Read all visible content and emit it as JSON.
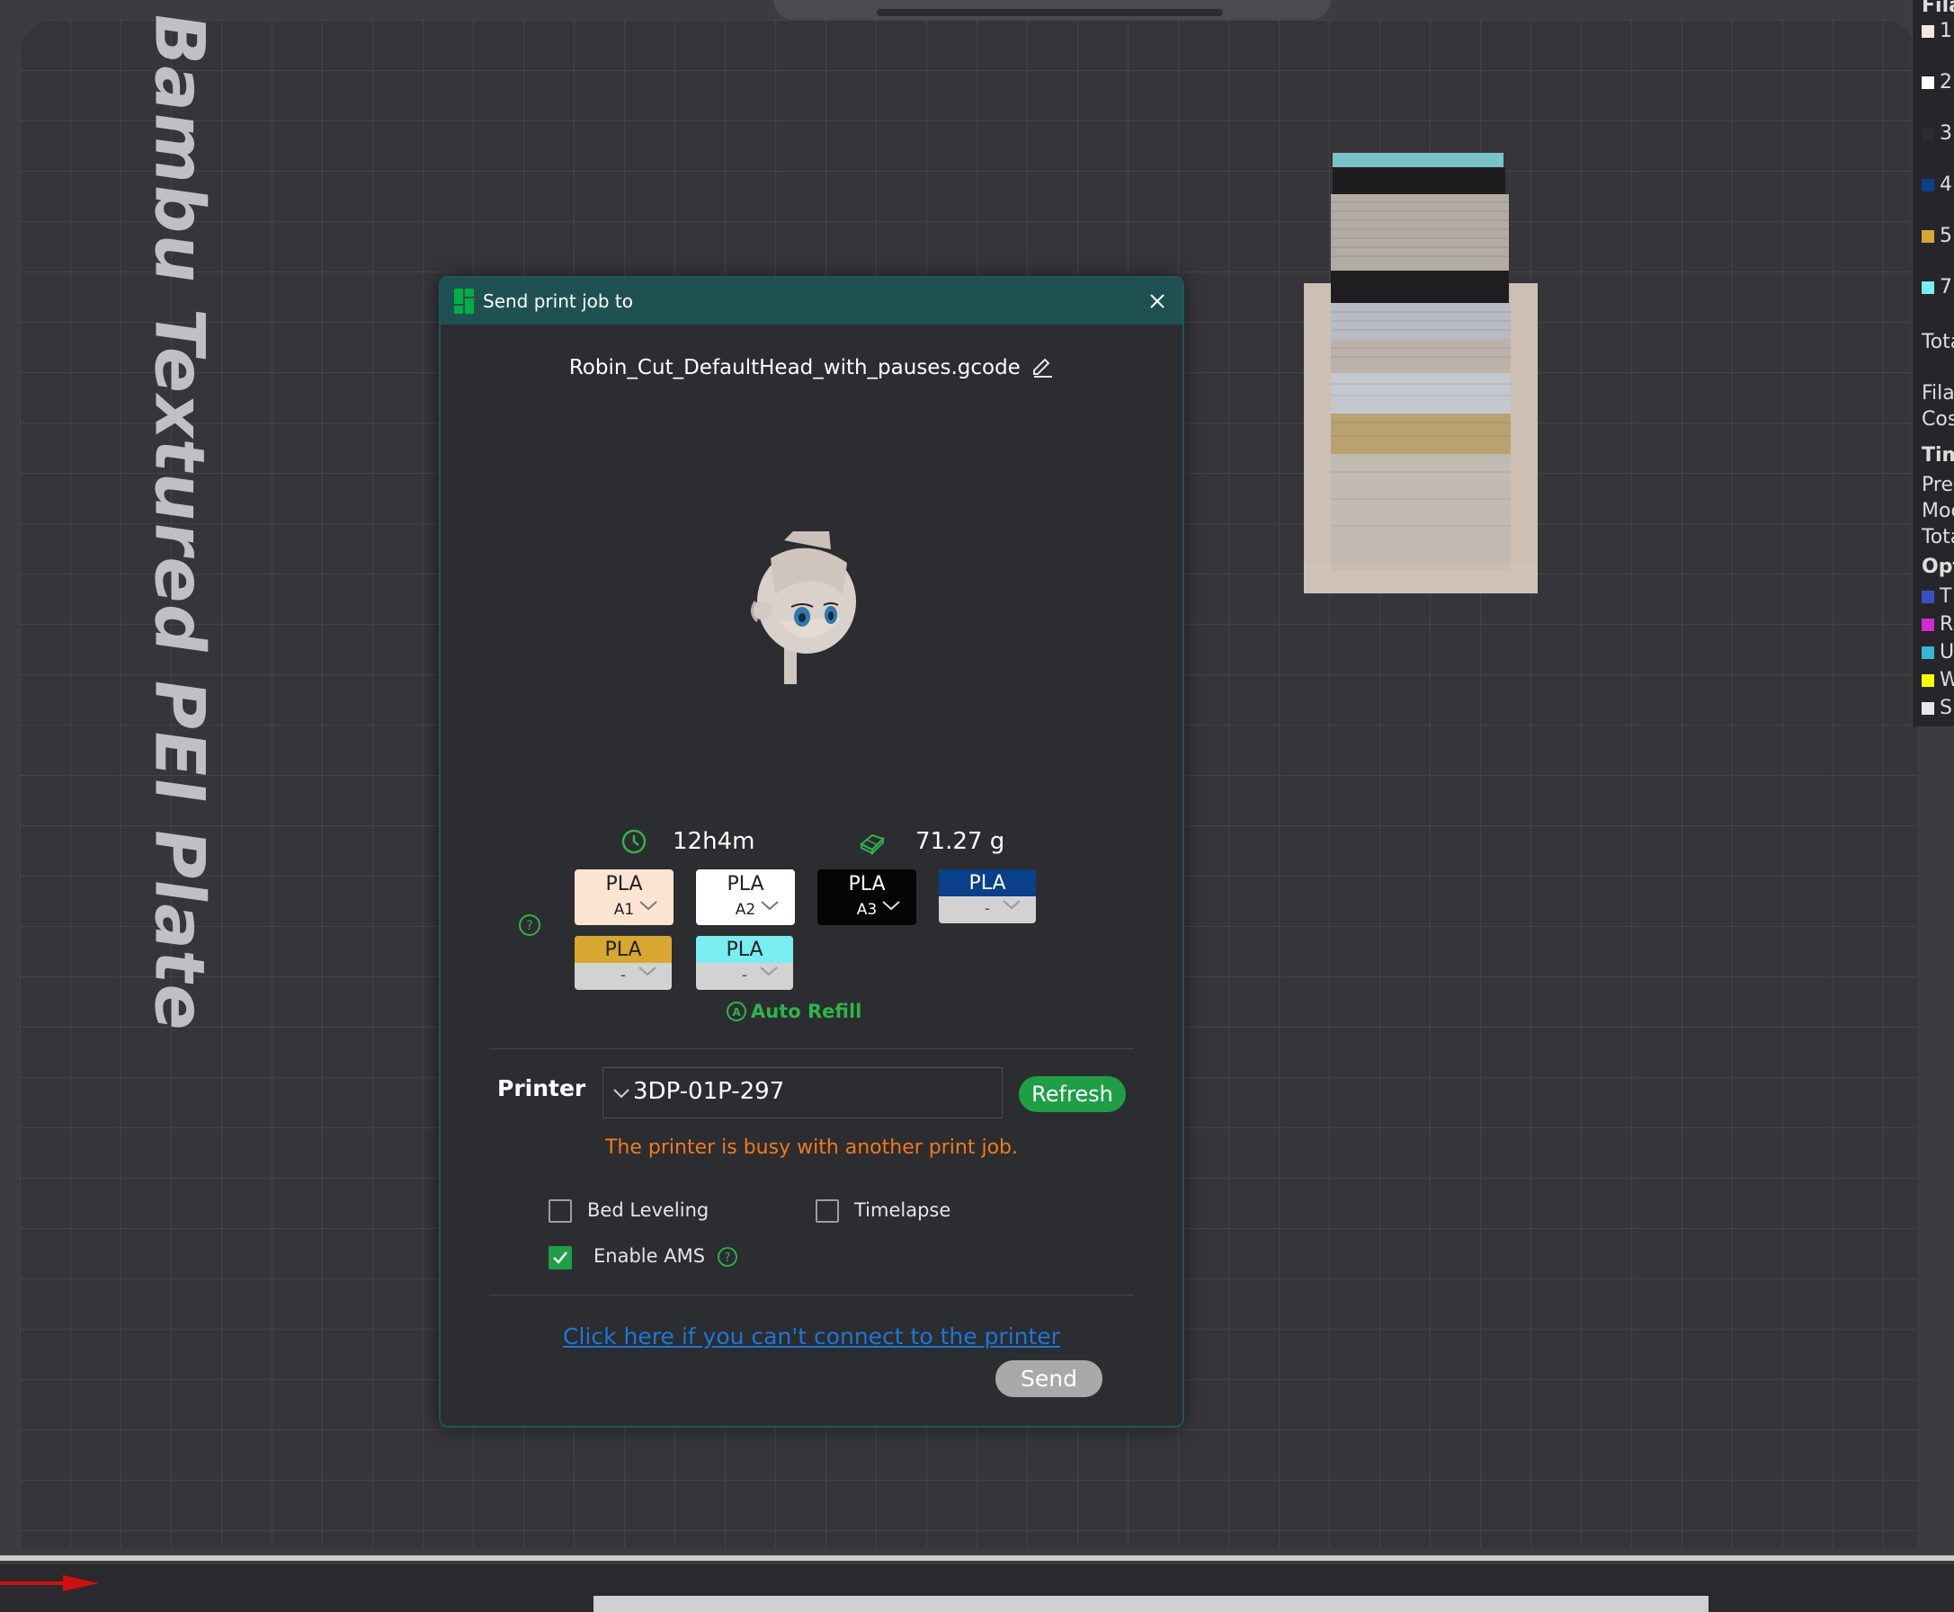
{
  "viewport": {
    "plate_label": "Bambu Textured PEI Plate"
  },
  "side_panel": {
    "header": "Fila",
    "filaments": [
      {
        "label": "1",
        "color": "#f7e6d7"
      },
      {
        "label": "2",
        "color": "#ffffff"
      },
      {
        "label": "3",
        "color": "#2d2d2d"
      },
      {
        "label": "4",
        "color": "#0a3f8a"
      },
      {
        "label": "5",
        "color": "#d7a731"
      },
      {
        "label": "7",
        "color": "#78eef0"
      }
    ],
    "total_1": "Tota",
    "filament": "Filar",
    "cost": "Cos",
    "time_header": "Tim",
    "prep": "Prep",
    "model": "Moc",
    "total_2": "Tota",
    "options_header": "Opt",
    "options": [
      {
        "label": "T",
        "color": "#3d4dc8"
      },
      {
        "label": "R",
        "color": "#d02ad0"
      },
      {
        "label": "U",
        "color": "#38b4d8"
      },
      {
        "label": "W",
        "color": "#ffff00"
      },
      {
        "label": "S",
        "color": "#e6e6e6"
      }
    ]
  },
  "dialog": {
    "title": "Send print job to",
    "filename": "Robin_Cut_DefaultHead_with_pauses.gcode",
    "print_time": "12h4m",
    "weight": "71.27 g",
    "filaments": [
      {
        "type": "PLA",
        "slot": "A1",
        "color": "#fbe4d2",
        "text_color": "#222222",
        "bottom_color": "#fbe4d2"
      },
      {
        "type": "PLA",
        "slot": "A2",
        "color": "#ffffff",
        "text_color": "#222222",
        "bottom_color": "#ffffff"
      },
      {
        "type": "PLA",
        "slot": "A3",
        "color": "#050505",
        "text_color": "#ffffff",
        "bottom_color": "#050505"
      },
      {
        "type": "PLA",
        "slot": "-",
        "color": "#0a3f8a",
        "text_color": "#ffffff",
        "bottom_color": "#d2d2d2"
      },
      {
        "type": "PLA",
        "slot": "-",
        "color": "#d7a731",
        "text_color": "#222222",
        "bottom_color": "#d2d2d2"
      },
      {
        "type": "PLA",
        "slot": "-",
        "color": "#78eef0",
        "text_color": "#222222",
        "bottom_color": "#d2d2d2"
      }
    ],
    "auto_refill": "Auto Refill",
    "printer_label": "Printer",
    "printer_value": "3DP-01P-297",
    "refresh_label": "Refresh",
    "busy_message": "The printer is busy with another print job.",
    "options": {
      "bed_leveling": {
        "label": "Bed Leveling",
        "checked": false
      },
      "timelapse": {
        "label": "Timelapse",
        "checked": false
      },
      "enable_ams": {
        "label": "Enable AMS",
        "checked": true
      }
    },
    "connect_link": "Click here if you can't connect to the printer",
    "send_label": "Send"
  },
  "colors": {
    "accent_green": "#1f9e46",
    "title_bar": "#1f5152",
    "warning": "#f07a1e",
    "link": "#1f76d6"
  }
}
